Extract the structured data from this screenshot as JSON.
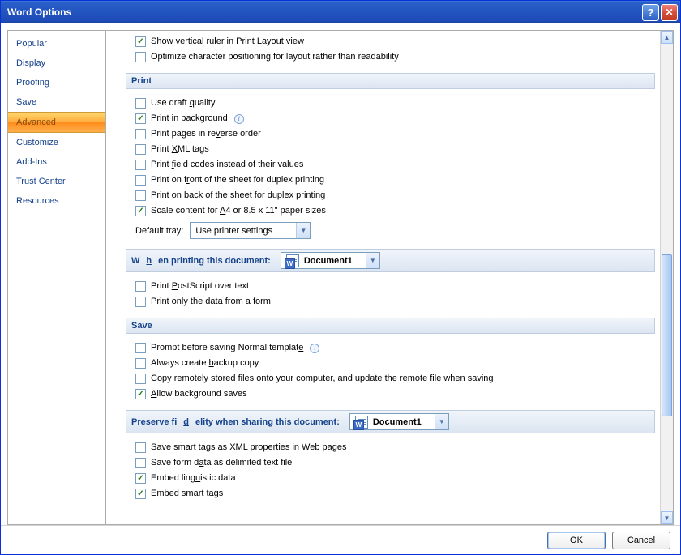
{
  "title": "Word Options",
  "sidebar": {
    "items": [
      {
        "label": "Popular"
      },
      {
        "label": "Display"
      },
      {
        "label": "Proofing"
      },
      {
        "label": "Save"
      },
      {
        "label": "Advanced",
        "selected": true
      },
      {
        "label": "Customize"
      },
      {
        "label": "Add-Ins"
      },
      {
        "label": "Trust Center"
      },
      {
        "label": "Resources"
      }
    ]
  },
  "top_checks": [
    {
      "label": "Show vertical ruler in Print Layout view",
      "checked": true,
      "accel": ""
    },
    {
      "label": "Optimize character positioning for layout rather than readability",
      "checked": false,
      "accel": ""
    }
  ],
  "sections": {
    "print": {
      "title": "Print",
      "checks": [
        {
          "pre": "Use draft ",
          "u": "q",
          "post": "uality",
          "checked": false
        },
        {
          "pre": "Print in ",
          "u": "b",
          "post": "ackground",
          "checked": true,
          "info": true
        },
        {
          "pre": "Print pages in re",
          "u": "v",
          "post": "erse order",
          "checked": false
        },
        {
          "pre": "Print ",
          "u": "X",
          "post": "ML tags",
          "checked": false
        },
        {
          "pre": "Print ",
          "u": "f",
          "post": "ield codes instead of their values",
          "checked": false
        },
        {
          "pre": "Print on f",
          "u": "r",
          "post": "ont of the sheet for duplex printing",
          "checked": false
        },
        {
          "pre": "Print on bac",
          "u": "k",
          "post": " of the sheet for duplex printing",
          "checked": false
        },
        {
          "pre": "Scale content for ",
          "u": "A",
          "post": "4 or 8.5 x 11\" paper sizes",
          "checked": true
        }
      ],
      "tray_label": "Default tray:",
      "tray_value": "Use printer settings"
    },
    "printing_doc": {
      "title_pre": "W",
      "title_u": "h",
      "title_post": "en printing this document:",
      "doc": "Document1",
      "checks": [
        {
          "pre": "Print ",
          "u": "P",
          "post": "ostScript over text",
          "checked": false
        },
        {
          "pre": "Print only the ",
          "u": "d",
          "post": "ata from a form",
          "checked": false
        }
      ]
    },
    "save": {
      "title": "Save",
      "checks": [
        {
          "pre": "Prompt before saving Normal templat",
          "u": "e",
          "post": "",
          "checked": false,
          "info": true
        },
        {
          "pre": "Always create ",
          "u": "b",
          "post": "ackup copy",
          "checked": false
        },
        {
          "pre": "Copy remotely stored files onto your computer, and update the remote file when savin",
          "u": "g",
          "post": "",
          "checked": false
        },
        {
          "pre": "",
          "u": "A",
          "post": "llow background saves",
          "checked": true
        }
      ]
    },
    "fidelity": {
      "title_pre": "Preserve fi",
      "title_u": "d",
      "title_post": "elity when sharing this document:",
      "doc": "Document1",
      "checks": [
        {
          "pre": "Save smart tags as XML properties in Web pa",
          "u": "g",
          "post": "es",
          "checked": false
        },
        {
          "pre": "Save form d",
          "u": "a",
          "post": "ta as delimited text file",
          "checked": false
        },
        {
          "pre": "Embed ling",
          "u": "u",
          "post": "istic data",
          "checked": true
        },
        {
          "pre": "Embed s",
          "u": "m",
          "post": "art tags",
          "checked": true
        }
      ]
    }
  },
  "buttons": {
    "ok": "OK",
    "cancel": "Cancel"
  }
}
